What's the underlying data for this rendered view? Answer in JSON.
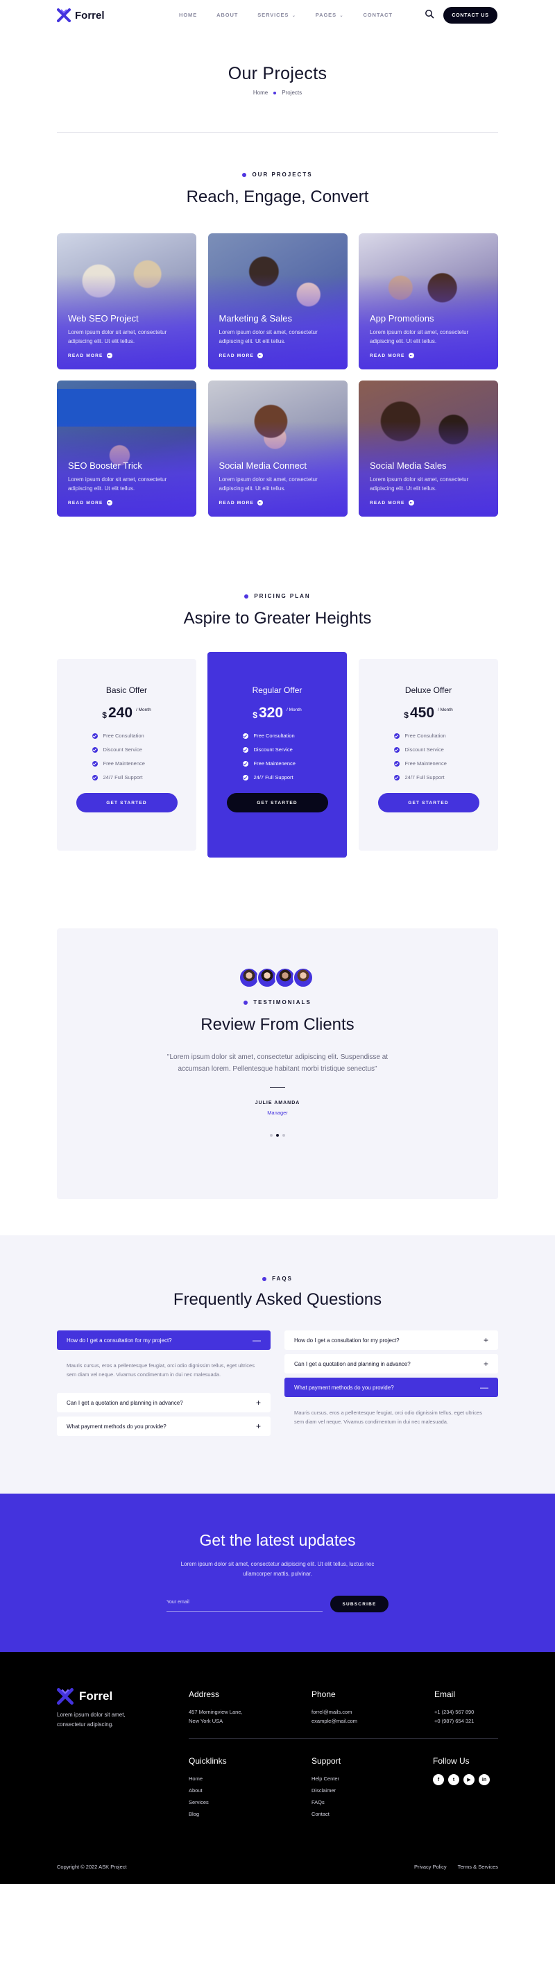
{
  "brand": {
    "name": "Forrel",
    "accent": "#4433dd"
  },
  "nav": {
    "items": [
      "HOME",
      "ABOUT",
      "SERVICES",
      "PAGES",
      "CONTACT"
    ],
    "active": "PAGES",
    "contact_button": "CONTACT US"
  },
  "hero": {
    "title": "Our Projects",
    "breadcrumb": [
      "Home",
      "Projects"
    ]
  },
  "projects": {
    "eyebrow": "OUR PROJECTS",
    "heading": "Reach, Engage, Convert",
    "read_more": "READ MORE",
    "desc": "Lorem ipsum dolor sit amet, consectetur adipiscing elit. Ut elit tellus.",
    "items": [
      {
        "title": "Web SEO Project"
      },
      {
        "title": "Marketing & Sales"
      },
      {
        "title": "App Promotions"
      },
      {
        "title": "SEO Booster Trick"
      },
      {
        "title": "Social Media Connect"
      },
      {
        "title": "Social Media Sales"
      }
    ]
  },
  "pricing": {
    "eyebrow": "PRICING PLAN",
    "heading": "Aspire to Greater Heights",
    "currency": "$",
    "per": "/ Month",
    "button": "GET STARTED",
    "features": [
      "Free Consultation",
      "Discount Service",
      "Free Maintenence",
      "24/7 Full Support"
    ],
    "plans": [
      {
        "name": "Basic Offer",
        "price": "240"
      },
      {
        "name": "Regular Offer",
        "price": "320"
      },
      {
        "name": "Deluxe Offer",
        "price": "450"
      }
    ]
  },
  "testimonials": {
    "eyebrow": "TESTIMONIALS",
    "heading": "Review From Clients",
    "quote": "\"Lorem ipsum dolor sit amet, consectetur adipiscing elit. Suspendisse at accumsan lorem. Pellentesque habitant morbi tristique senectus\"",
    "name": "JULIE AMANDA",
    "role": "Manager",
    "active_dot": 2
  },
  "faq": {
    "eyebrow": "FAQS",
    "heading": "Frequently Asked Questions",
    "answer": "Mauris cursus, eros a pellentesque feugiat, orci odio dignissim tellus, eget ultrices sem diam vel neque. Vivamus condimentum in dui nec malesuada.",
    "left": [
      {
        "q": "How do I get a consultation for my project?",
        "open": true
      },
      {
        "q": "Can I get a quotation and planning in advance?",
        "open": false
      },
      {
        "q": "What payment methods do you provide?",
        "open": false
      }
    ],
    "right": [
      {
        "q": "How do I get a consultation for my project?",
        "open": false
      },
      {
        "q": "Can I get a quotation and planning in advance?",
        "open": false
      },
      {
        "q": "What payment methods do you provide?",
        "open": true
      }
    ]
  },
  "updates": {
    "heading": "Get the latest updates",
    "text": "Lorem ipsum dolor sit amet, consectetur adipiscing elit. Ut elit tellus, luctus nec ullamcorper mattis, pulvinar.",
    "placeholder": "Your email",
    "button": "SUBSCRIBE"
  },
  "footer": {
    "desc": "Lorem ipsum dolor sit amet, consectetur adipiscing.",
    "address": {
      "title": "Address",
      "lines": [
        "457 Morningview Lane,",
        "New York USA"
      ]
    },
    "phone": {
      "title": "Phone",
      "lines": [
        "forrel@mails.com",
        "example@mail.com"
      ]
    },
    "email": {
      "title": "Email",
      "lines": [
        "+1 (234) 567 890",
        "+0 (987) 654 321"
      ]
    },
    "quicklinks": {
      "title": "Quicklinks",
      "items": [
        "Home",
        "About",
        "Services",
        "Blog"
      ]
    },
    "support": {
      "title": "Support",
      "items": [
        "Help Center",
        "Disclaimer",
        "FAQs",
        "Contact"
      ]
    },
    "follow": {
      "title": "Follow Us",
      "icons": [
        "facebook-icon",
        "twitter-icon",
        "youtube-icon",
        "linkedin-icon"
      ]
    },
    "copyright": "Copyright © 2022 ASK Project",
    "bottom_links": [
      "Privacy Policy",
      "Terms & Services"
    ]
  }
}
